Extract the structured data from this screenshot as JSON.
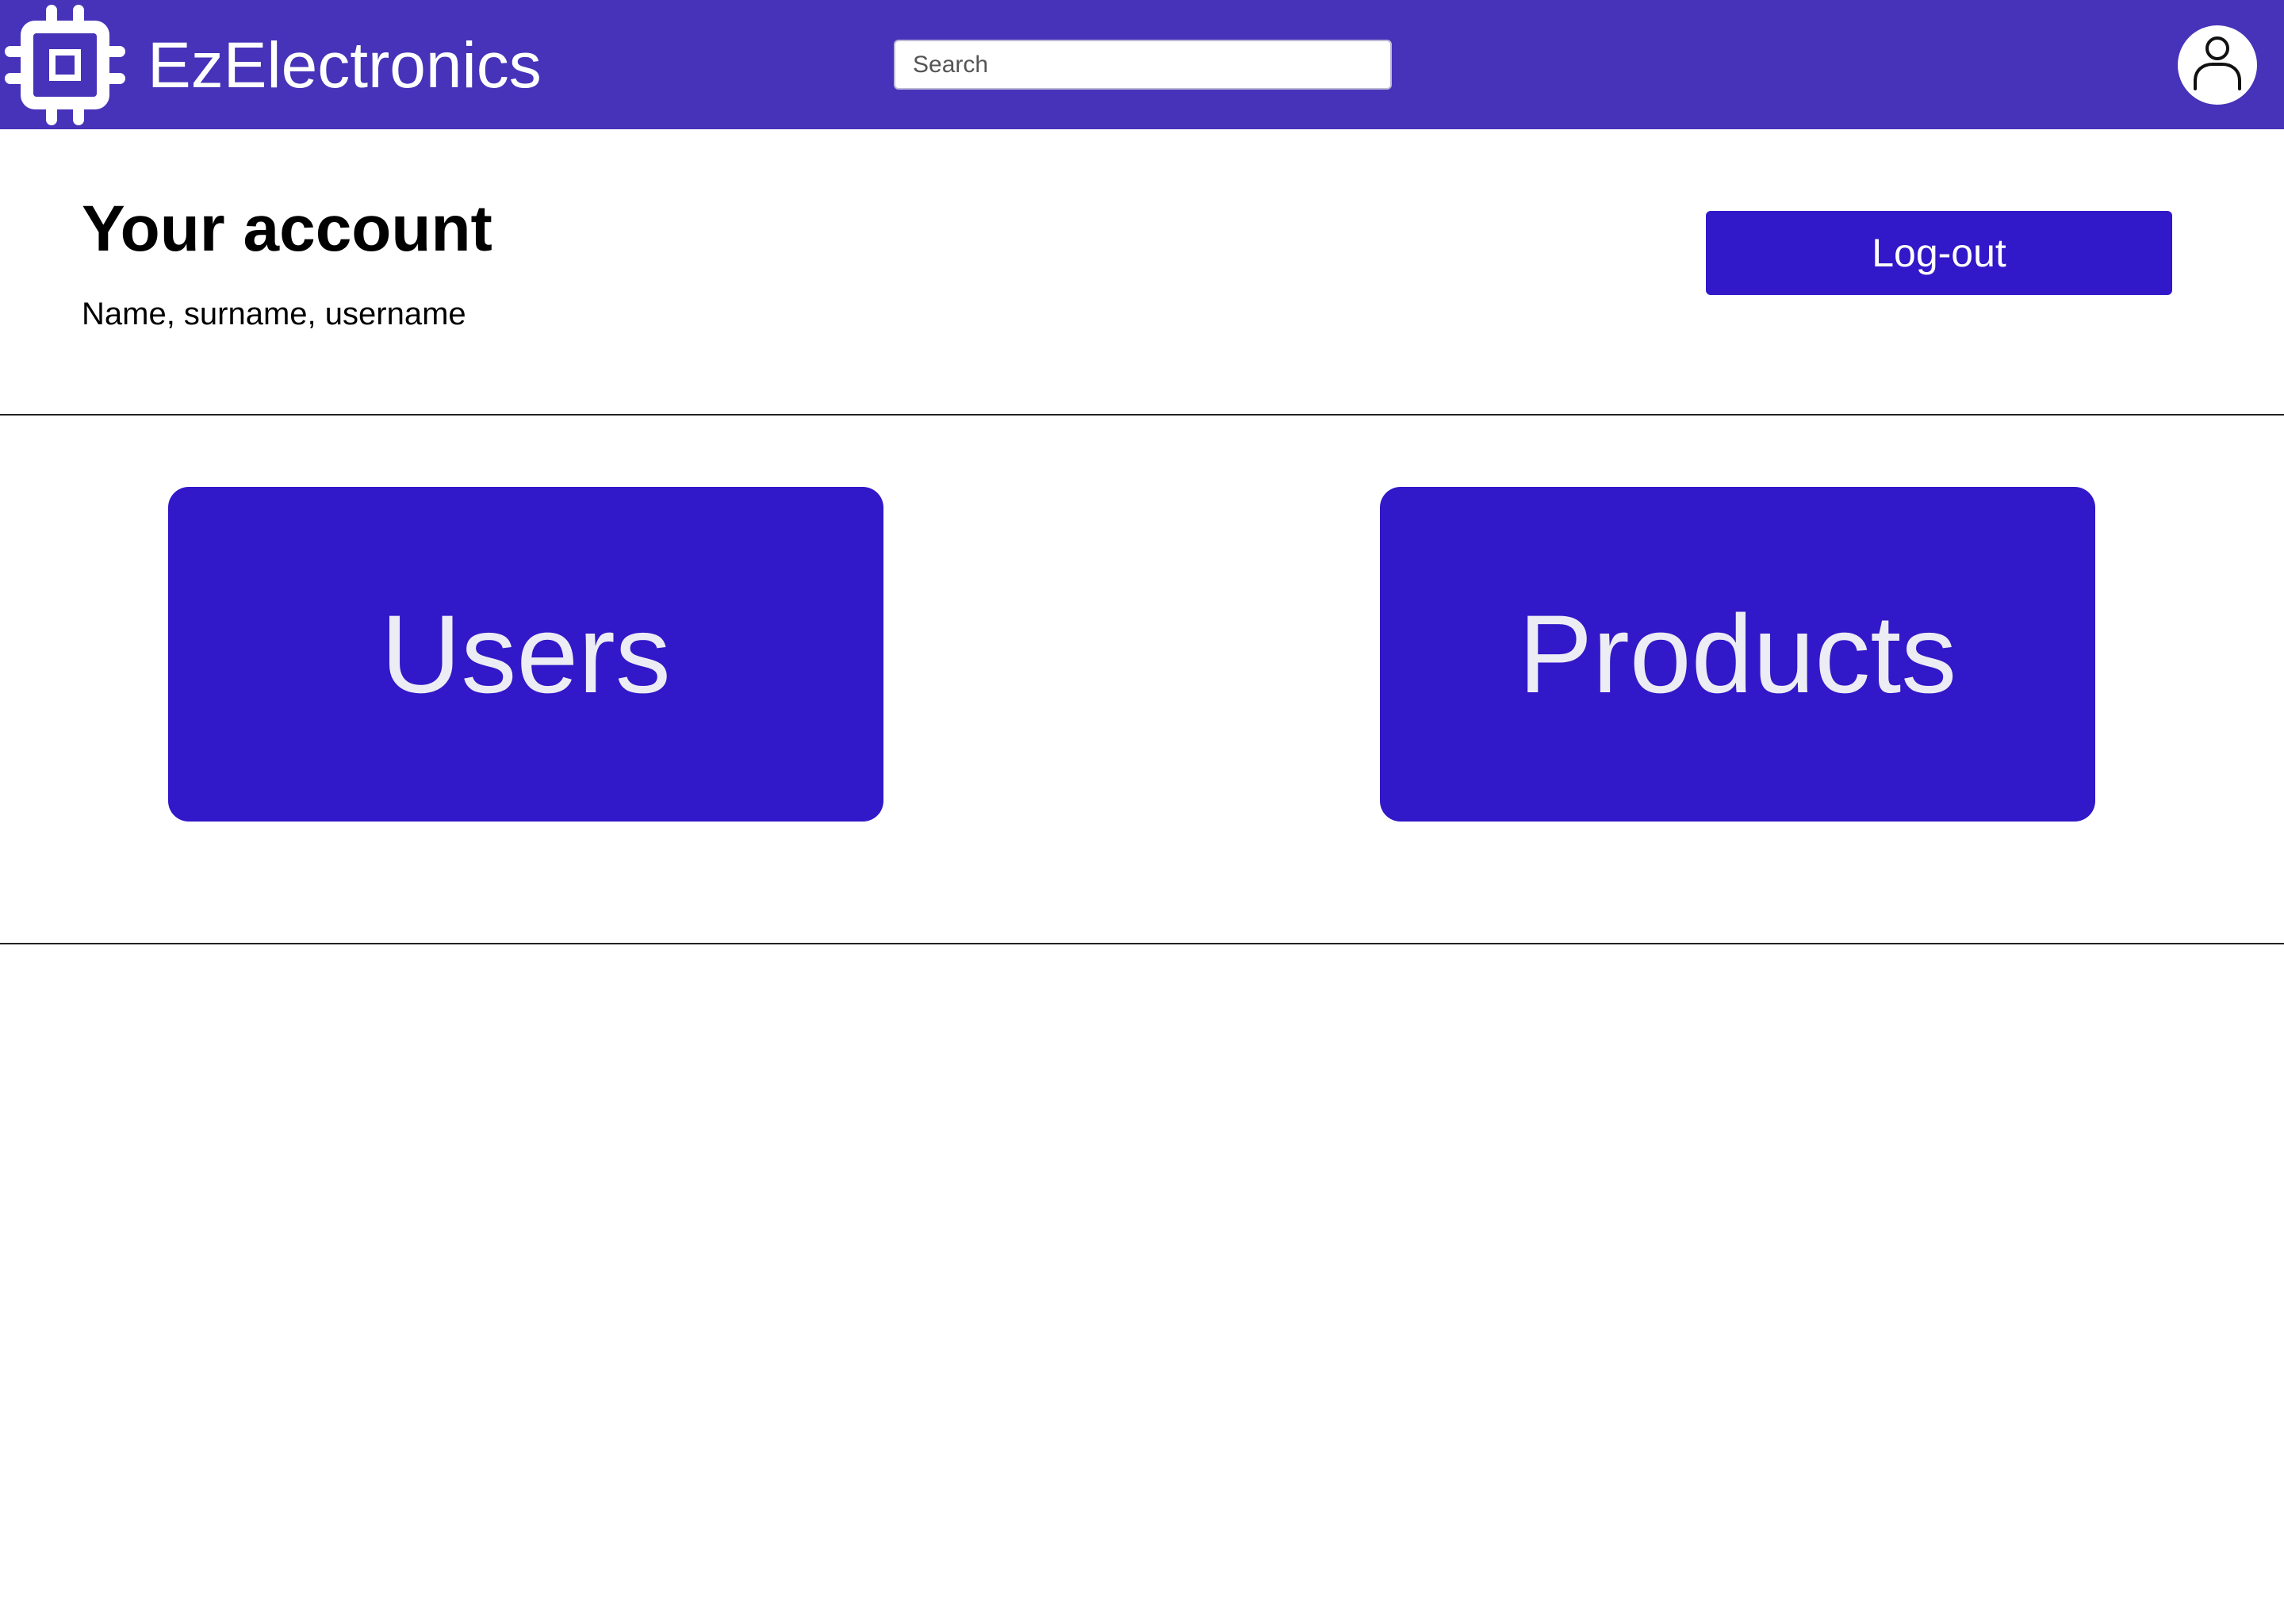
{
  "header": {
    "app_title": "EzElectronics",
    "logo_icon": "cpu-chip-icon",
    "search": {
      "placeholder": "Search",
      "value": ""
    },
    "avatar_icon": "user-icon",
    "background_color": "#4633b9"
  },
  "account": {
    "title": "Your account",
    "details": "Name, surname, username",
    "logout_label": "Log-out"
  },
  "tiles": {
    "users_label": "Users",
    "products_label": "Products",
    "color": "#3118c8"
  }
}
